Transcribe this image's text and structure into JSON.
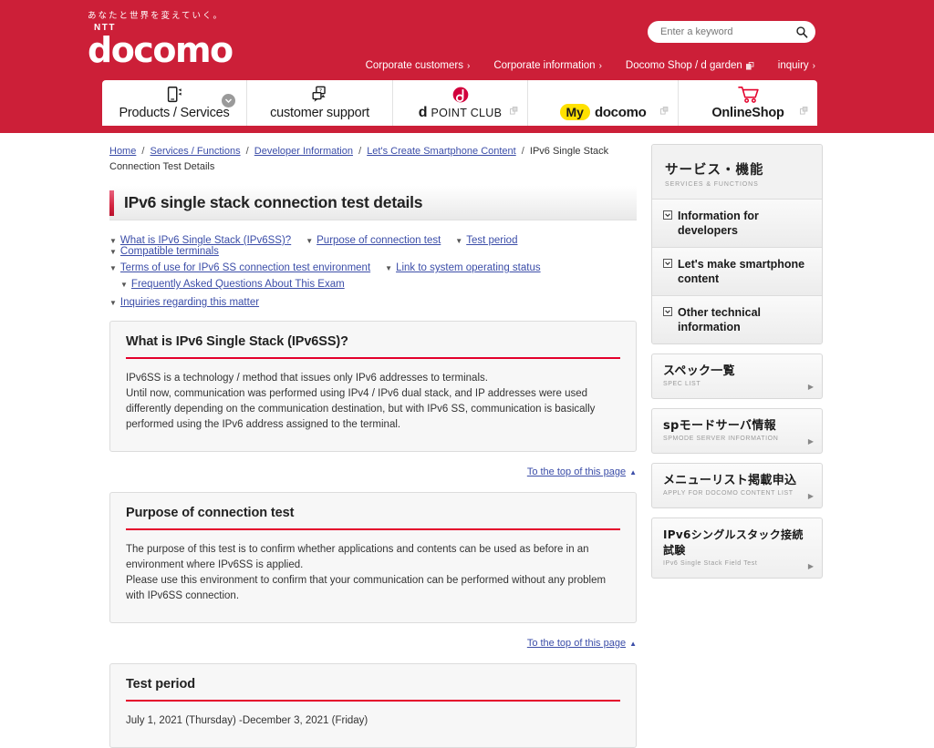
{
  "header": {
    "tagline": "あなたと世界を変えていく。",
    "logo_ntt": "NTT",
    "logo_name": "docomo",
    "search": {
      "placeholder": "Enter a keyword",
      "value": "",
      "icon": "search-icon"
    },
    "utility_links": [
      {
        "label": "Corporate customers",
        "marker": "›"
      },
      {
        "label": "Corporate information",
        "marker": "›"
      },
      {
        "label": "Docomo Shop / d garden",
        "marker": "external"
      },
      {
        "label": "inquiry",
        "marker": "›"
      }
    ],
    "main_nav": [
      {
        "label": "Products / Services",
        "icon": "smartphone-icon",
        "badge": "chevron-down-icon"
      },
      {
        "label": "customer support",
        "icon": "chat-question-icon"
      },
      {
        "label_d": "d",
        "label": "POINT CLUB",
        "icon": "d-point-logo-icon",
        "external": true
      },
      {
        "badge_label": "My",
        "label": "docomo",
        "external": true
      },
      {
        "label": "OnlineShop",
        "icon": "shopping-cart-icon",
        "external": true
      }
    ]
  },
  "breadcrumb": {
    "items": [
      {
        "label": "Home",
        "link": true
      },
      {
        "label": "Services / Functions",
        "link": true
      },
      {
        "label": "Developer Information",
        "link": true
      },
      {
        "label": "Let's Create Smartphone Content",
        "link": true
      },
      {
        "label": "IPv6 Single Stack Connection Test Details",
        "link": false
      }
    ],
    "separator": "/"
  },
  "page_title": "IPv6 single stack connection test details",
  "anchor_links": {
    "rows": [
      [
        "What is IPv6 Single Stack (IPv6SS)?",
        "Purpose of connection test",
        "Test period",
        "Compatible terminals"
      ],
      [
        "Terms of use for IPv6 SS connection test environment",
        "Link to system operating status"
      ],
      [
        "Frequently Asked Questions About This Exam"
      ],
      [
        "Inquiries regarding this matter"
      ]
    ],
    "marker": "▼"
  },
  "sections": [
    {
      "heading": "What is IPv6 Single Stack (IPv6SS)?",
      "paragraphs": [
        "IPv6SS is a technology / method that issues only IPv6 addresses to terminals.",
        "Until now, communication was performed using IPv4 / IPv6 dual stack, and IP addresses were used differently depending on the communication destination, but with IPv6 SS, communication is basically performed using the IPv6 address assigned to the terminal."
      ]
    },
    {
      "heading": "Purpose of connection test",
      "paragraphs": [
        "The purpose of this test is to confirm whether applications and contents can be used as before in an environment where IPv6SS is applied.",
        "Please use this environment to confirm that your communication can be performed without any problem with IPv6SS connection."
      ]
    },
    {
      "heading": "Test period",
      "paragraphs": [
        "July 1, 2021 (Thursday) -December 3, 2021 (Friday)"
      ]
    }
  ],
  "to_top_label": "To the top of this page",
  "to_top_marker": "▲",
  "sidebar": {
    "panel": {
      "title_ja": "サービス・機能",
      "title_en": "SERVICES & FUNCTIONS",
      "items": [
        {
          "label": "Information for developers",
          "icon": "square-chevron-icon"
        },
        {
          "label": "Let's make smartphone content",
          "icon": "square-chevron-icon"
        },
        {
          "label": "Other technical information",
          "icon": "square-chevron-icon"
        }
      ]
    },
    "cards": [
      {
        "title_ja": "スペック一覧",
        "title_en": "SPEC LIST",
        "arrow": "▶"
      },
      {
        "title_ja": "spモードサーバ情報",
        "title_en": "SPMODE SERVER INFORMATION",
        "arrow": "▶"
      },
      {
        "title_ja": "メニューリスト掲載申込",
        "title_en": "APPLY FOR DOCOMO CONTENT LIST",
        "arrow": "▶"
      },
      {
        "title_ja": "IPv6シングルスタック接続試験",
        "title_en": "IPv6 Single Stack Field Test",
        "arrow": "▶"
      }
    ]
  },
  "colors": {
    "brand_red": "#cc1f38",
    "accent_red": "#e4002b",
    "link_blue": "#3b4da8",
    "my_yellow": "#ffe100"
  }
}
